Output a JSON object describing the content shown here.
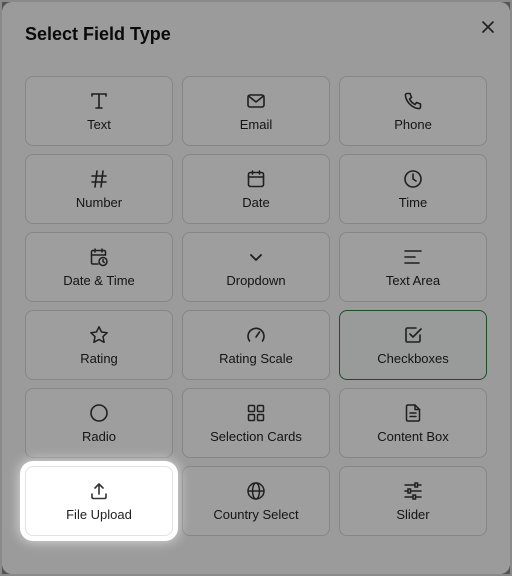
{
  "dialog": {
    "title": "Select Field Type",
    "close_icon": "close-icon",
    "accent_color": "#2e7d46",
    "selected": "Checkboxes",
    "focused": "File Upload",
    "items": [
      {
        "label": "Text",
        "icon": "text-type-icon"
      },
      {
        "label": "Email",
        "icon": "envelope-icon"
      },
      {
        "label": "Phone",
        "icon": "phone-icon"
      },
      {
        "label": "Number",
        "icon": "hash-icon"
      },
      {
        "label": "Date",
        "icon": "calendar-icon"
      },
      {
        "label": "Time",
        "icon": "clock-icon"
      },
      {
        "label": "Date & Time",
        "icon": "calendar-clock-icon"
      },
      {
        "label": "Dropdown",
        "icon": "chevron-down-icon"
      },
      {
        "label": "Text Area",
        "icon": "text-lines-icon"
      },
      {
        "label": "Rating",
        "icon": "star-icon"
      },
      {
        "label": "Rating Scale",
        "icon": "gauge-icon"
      },
      {
        "label": "Checkboxes",
        "icon": "checkbox-icon"
      },
      {
        "label": "Radio",
        "icon": "circle-icon"
      },
      {
        "label": "Selection Cards",
        "icon": "grid-icon"
      },
      {
        "label": "Content Box",
        "icon": "document-icon"
      },
      {
        "label": "File Upload",
        "icon": "upload-icon"
      },
      {
        "label": "Country Select",
        "icon": "globe-icon"
      },
      {
        "label": "Slider",
        "icon": "sliders-icon"
      }
    ]
  }
}
